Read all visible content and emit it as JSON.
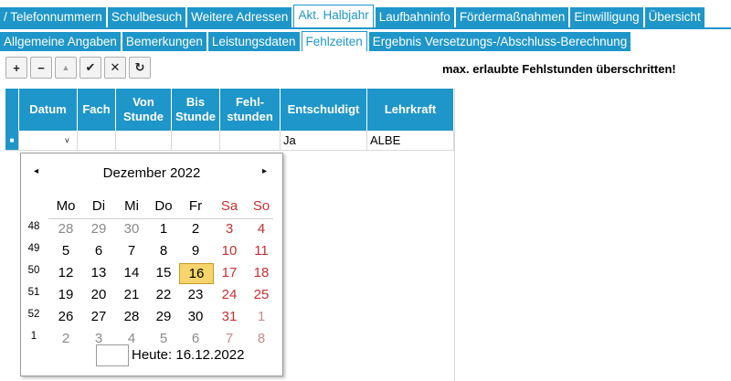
{
  "tabs_row1": [
    "/ Telefonnummern",
    "Schulbesuch",
    "Weitere Adressen",
    "Akt. Halbjahr",
    "Laufbahninfo",
    "Fördermaßnahmen",
    "Einwilligung",
    "Übersicht"
  ],
  "tabs_row2": [
    "Allgemeine Angaben",
    "Bemerkungen",
    "Leistungsdaten",
    "Fehlzeiten",
    "Ergebnis Versetzungs-/Abschluss-Berechnung"
  ],
  "toolbar": {
    "add": "+",
    "remove": "−",
    "up": "▲",
    "ok": "✔",
    "cancel": "✕",
    "refresh": "↻"
  },
  "warning": "max. erlaubte Fehlstunden überschritten!",
  "grid": {
    "columns": [
      "Datum",
      "Fach",
      "Von Stunde",
      "Bis Stunde",
      "Fehl-stunden",
      "Entschuldigt",
      "Lehrkraft"
    ],
    "row": {
      "datum": "˅",
      "fach": "",
      "von": "",
      "bis": "",
      "fehlstunden": "",
      "entschuldigt": "Ja",
      "lehrkraft": "ALBE"
    }
  },
  "calendar": {
    "month": "Dezember 2022",
    "prev": "◂",
    "next": "▸",
    "weekdays": [
      "Mo",
      "Di",
      "Mi",
      "Do",
      "Fr",
      "Sa",
      "So"
    ],
    "weeks": [
      {
        "num": "48",
        "days": [
          "28",
          "29",
          "30",
          "1",
          "2",
          "3",
          "4"
        ]
      },
      {
        "num": "49",
        "days": [
          "5",
          "6",
          "7",
          "8",
          "9",
          "10",
          "11"
        ]
      },
      {
        "num": "50",
        "days": [
          "12",
          "13",
          "14",
          "15",
          "16",
          "17",
          "18"
        ]
      },
      {
        "num": "51",
        "days": [
          "19",
          "20",
          "21",
          "22",
          "23",
          "24",
          "25"
        ]
      },
      {
        "num": "52",
        "days": [
          "26",
          "27",
          "28",
          "29",
          "30",
          "31",
          "1"
        ]
      },
      {
        "num": "1",
        "days": [
          "2",
          "3",
          "4",
          "5",
          "6",
          "7",
          "8"
        ]
      }
    ],
    "today_label": "Heute: 16.12.2022"
  },
  "colors": {
    "accent": "#1f96c9",
    "weekend": "#c83030",
    "today": "#f7d46c"
  }
}
